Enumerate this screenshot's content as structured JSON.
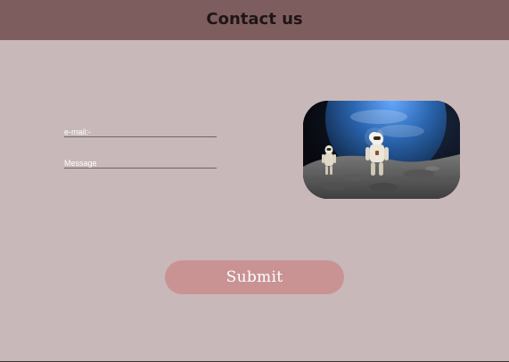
{
  "header": {
    "title": "Contact us"
  },
  "form": {
    "email_label": "e-mail:-",
    "message_label": "Message",
    "submit_label": "Submit"
  },
  "colors": {
    "page_background": "#c8b8b9",
    "header_background": "#7e5d5f",
    "submit_background": "#c99394"
  },
  "image": {
    "subject": "astronauts-on-moon-with-earth"
  }
}
